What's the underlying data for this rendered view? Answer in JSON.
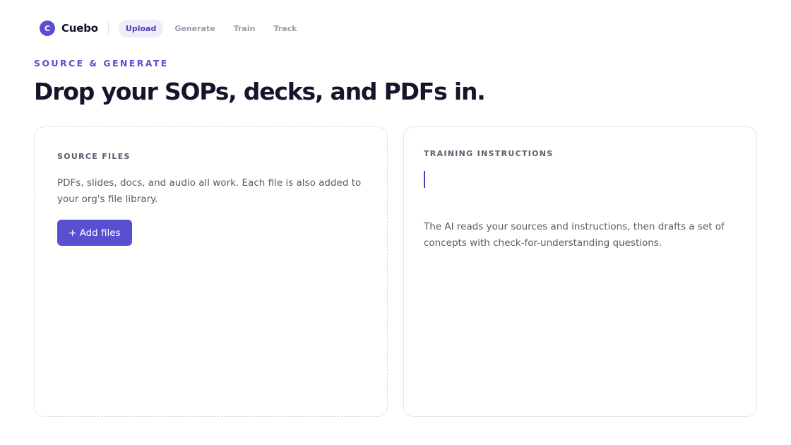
{
  "brand": {
    "mark": "C",
    "name": "Cuebo"
  },
  "nav": {
    "tabs": [
      {
        "label": "Upload",
        "active": true
      },
      {
        "label": "Generate",
        "active": false
      },
      {
        "label": "Train",
        "active": false
      },
      {
        "label": "Track",
        "active": false
      }
    ]
  },
  "hero": {
    "eyebrow": "SOURCE & GENERATE",
    "headline": "Drop your SOPs, decks, and PDFs in."
  },
  "source_files": {
    "label": "SOURCE FILES",
    "description": "PDFs, slides, docs, and audio all work. Each file is also added to your org's file library.",
    "add_button": "+ Add files"
  },
  "training_instructions": {
    "label": "TRAINING INSTRUCTIONS",
    "value": "",
    "help": "The AI reads your sources and instructions, then drafts a set of concepts with check-for-understanding questions."
  },
  "colors": {
    "accent": "#5b4fd1",
    "accent_soft": "#efecfb",
    "text": "#14142b",
    "muted": "#5a5a68"
  }
}
